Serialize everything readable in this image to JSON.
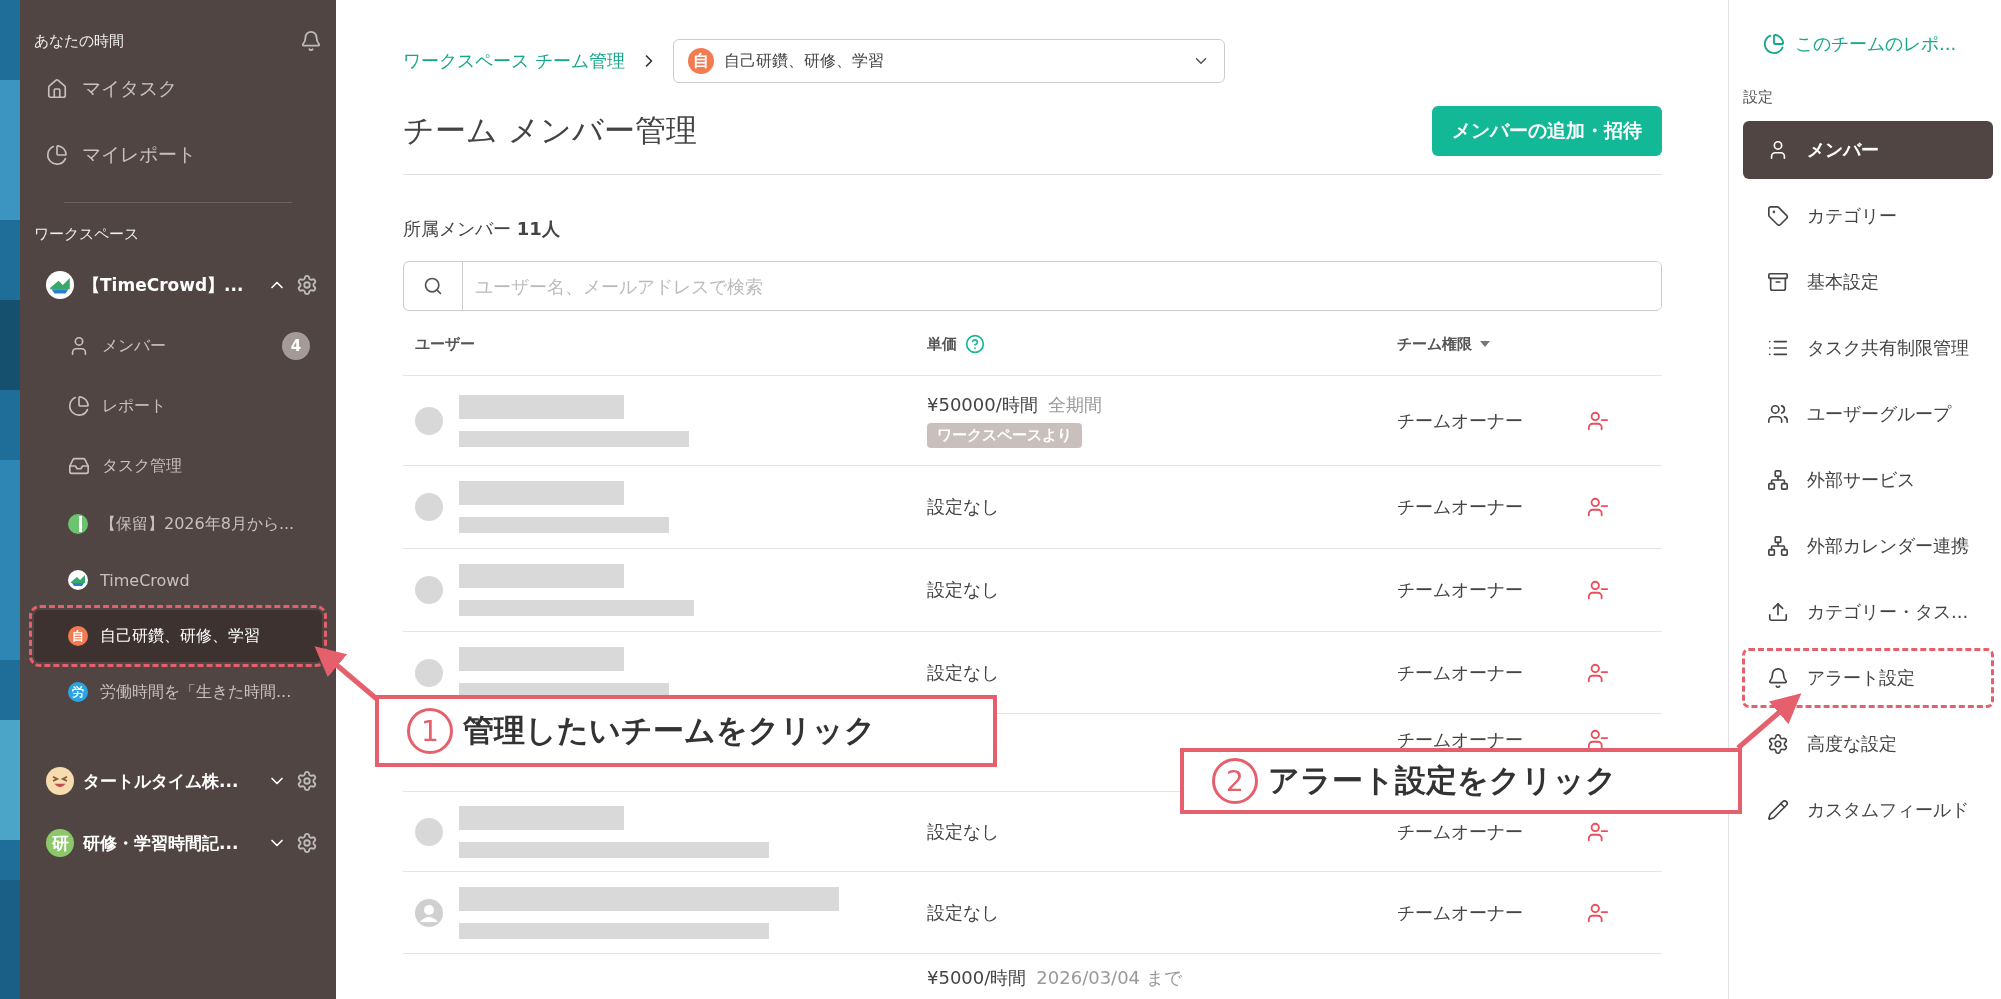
{
  "sidebar": {
    "section_title": "あなたの時間",
    "nav": [
      {
        "label": "マイタスク"
      },
      {
        "label": "マイレポート"
      }
    ],
    "workspace_label": "ワークスペース",
    "workspaces": [
      {
        "name": "【TimeCrowd】...",
        "avatar": {
          "kind": "logo"
        },
        "expanded": true,
        "items": [
          {
            "kind": "nav",
            "label": "メンバー",
            "badge": "4"
          },
          {
            "kind": "nav",
            "label": "レポート"
          },
          {
            "kind": "nav",
            "label": "タスク管理"
          },
          {
            "kind": "team",
            "label": "【保留】2026年8月から...",
            "avatar": {
              "kind": "half",
              "color": "#6cc46e"
            },
            "selected": false,
            "highlighted": false
          },
          {
            "kind": "team",
            "label": "TimeCrowd",
            "avatar": {
              "kind": "logo"
            },
            "selected": false,
            "highlighted": false
          },
          {
            "kind": "team",
            "label": "自己研鑽、研修、学習",
            "avatar": {
              "kind": "char",
              "char": "自",
              "color": "#f47a52"
            },
            "selected": true,
            "highlighted": true
          },
          {
            "kind": "team",
            "label": "労働時間を「生きた時間...",
            "avatar": {
              "kind": "char",
              "char": "労",
              "color": "#2ba4e6"
            },
            "selected": false,
            "highlighted": false
          }
        ]
      },
      {
        "name": "タートルタイム株...",
        "avatar": {
          "kind": "emoji",
          "color": "#f7dcb0"
        },
        "expanded": false
      },
      {
        "name": "研修・学習時間記...",
        "avatar": {
          "kind": "char",
          "char": "研",
          "color": "#8cc86a"
        },
        "expanded": false
      }
    ]
  },
  "breadcrumb": {
    "link": "ワークスペース チーム管理",
    "team": {
      "char": "自",
      "color": "#f47a52",
      "name": "自己研鑽、研修、学習"
    }
  },
  "page_title": "チーム メンバー管理",
  "add_button": "メンバーの追加・招待",
  "member_count": {
    "label": "所属メンバー",
    "count": "11人"
  },
  "search": {
    "placeholder": "ユーザー名、メールアドレスで検索"
  },
  "table": {
    "columns": [
      {
        "label": "ユーザー"
      },
      {
        "label": "単価",
        "help": true
      },
      {
        "label": "チーム権限",
        "sort": true
      }
    ],
    "rows": [
      {
        "kind": "member",
        "rate": "¥50000/時間",
        "rate_note": "全期間",
        "tag": "ワークスペースより",
        "role": "チームオーナー"
      },
      {
        "kind": "member",
        "rate": "設定なし",
        "role": "チームオーナー"
      },
      {
        "kind": "member",
        "rate": "設定なし",
        "role": "チームオーナー"
      },
      {
        "kind": "member",
        "rate": "設定なし",
        "role": "チームオーナー"
      },
      {
        "kind": "covered",
        "role": "チームオーナー"
      },
      {
        "kind": "member",
        "rate": "設定なし",
        "role": "チームオーナー"
      },
      {
        "kind": "silhouette",
        "rate": "設定なし",
        "role": "チームオーナー"
      },
      {
        "kind": "cut",
        "rate": "¥5000/時間",
        "rate_note": "2026/03/04 まで"
      }
    ]
  },
  "settings_panel": {
    "report_link": "このチームのレポ...",
    "title": "設定",
    "items": [
      {
        "label": "メンバー",
        "selected": true,
        "highlighted": false
      },
      {
        "label": "カテゴリー",
        "selected": false,
        "highlighted": false
      },
      {
        "label": "基本設定",
        "selected": false,
        "highlighted": false
      },
      {
        "label": "タスク共有制限管理",
        "selected": false,
        "highlighted": false
      },
      {
        "label": "ユーザーグループ",
        "selected": false,
        "highlighted": false
      },
      {
        "label": "外部サービス",
        "selected": false,
        "highlighted": false
      },
      {
        "label": "外部カレンダー連携",
        "selected": false,
        "highlighted": false
      },
      {
        "label": "カテゴリー・タス...",
        "selected": false,
        "highlighted": false
      },
      {
        "label": "アラート設定",
        "selected": false,
        "highlighted": true
      },
      {
        "label": "高度な設定",
        "selected": false,
        "highlighted": false
      },
      {
        "label": "カスタムフィールド",
        "selected": false,
        "highlighted": false
      }
    ]
  },
  "callouts": [
    {
      "number": "1",
      "text": "管理したいチームをクリック"
    },
    {
      "number": "2",
      "text": "アラート設定をクリック"
    }
  ]
}
